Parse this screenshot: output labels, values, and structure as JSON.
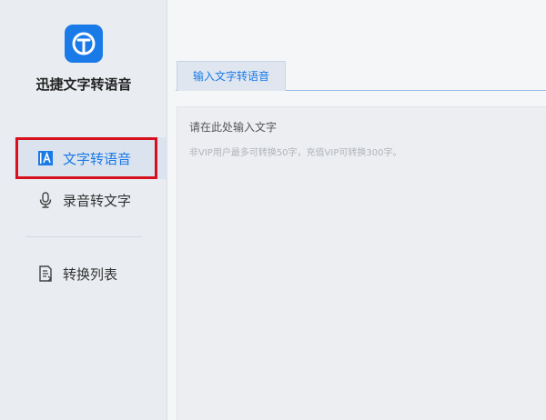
{
  "app": {
    "title": "迅捷文字转语音"
  },
  "sidebar": {
    "items": [
      {
        "label": "文字转语音",
        "icon": "text-to-speech-icon",
        "active": true
      },
      {
        "label": "录音转文字",
        "icon": "microphone-icon",
        "active": false
      },
      {
        "label": "转换列表",
        "icon": "document-list-icon",
        "active": false
      }
    ]
  },
  "main": {
    "tabs": [
      {
        "label": "输入文字转语音",
        "active": true
      }
    ],
    "editor": {
      "placeholder": "请在此处输入文字",
      "hint": "非VIP用户最多可转换50字，充值VIP可转换300字。"
    }
  },
  "colors": {
    "accent": "#1a7ae8",
    "highlight": "#d6101e",
    "sidebar_bg": "#e9ecf1"
  }
}
